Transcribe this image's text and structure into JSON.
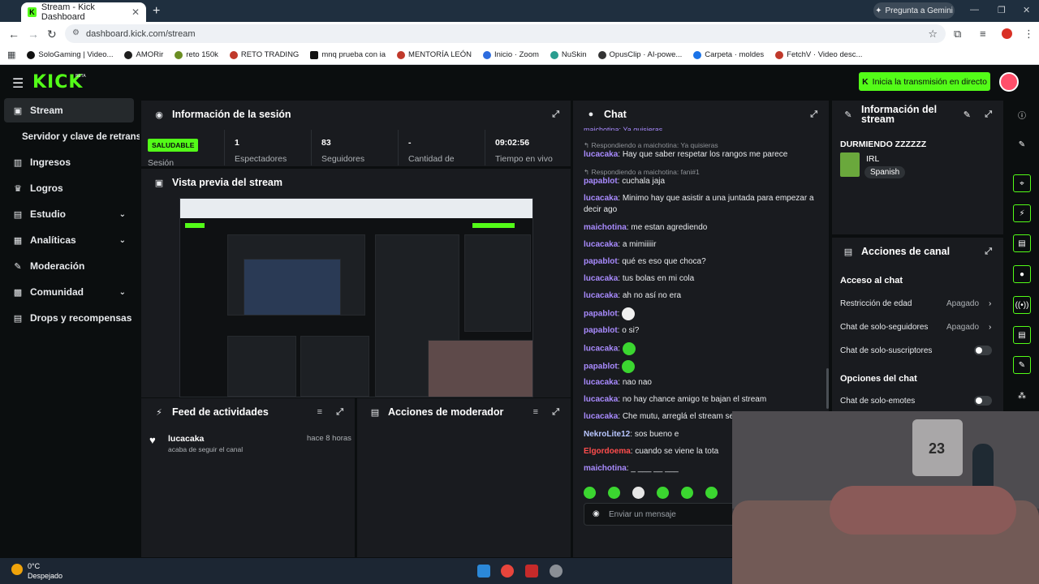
{
  "browser": {
    "tab_title": "Stream - Kick Dashboard",
    "url": "dashboard.kick.com/stream",
    "gemini_label": "Pregunta a Gemini",
    "bookmarks": [
      "SoloGaming | Video...",
      "AMORir",
      "reto 150k",
      "RETO TRADING",
      "mnq prueba con ia",
      "MENTORÍA LEÓN",
      "Inicio · Zoom",
      "NuSkin",
      "OpusClip · AI-powe...",
      "Carpeta · moldes",
      "FetchV · Video desc..."
    ]
  },
  "app": {
    "logo": "KICK",
    "beta": "BETA",
    "go_live_label": "Inicia la transmisión en directo"
  },
  "sidebar": {
    "items": [
      {
        "label": "Stream",
        "icon": "stream-icon"
      },
      {
        "label": "Servidor y clave de retransmisión"
      },
      {
        "label": "Ingresos",
        "icon": "chart-icon"
      },
      {
        "label": "Logros",
        "icon": "trophy-icon"
      },
      {
        "label": "Estudio",
        "icon": "studio-icon"
      },
      {
        "label": "Analíticas",
        "icon": "analytics-icon"
      },
      {
        "label": "Moderación",
        "icon": "wrench-icon"
      },
      {
        "label": "Comunidad",
        "icon": "community-icon"
      },
      {
        "label": "Drops y recompensas",
        "icon": "drops-icon"
      }
    ]
  },
  "session": {
    "title": "Información de la sesión",
    "health_badge": "SALUDABLE",
    "session_label": "Sesión",
    "stats": [
      {
        "value": "1",
        "label": "Espectadores"
      },
      {
        "value": "83",
        "label": "Seguidores"
      },
      {
        "value": "-",
        "label": "Cantidad de"
      },
      {
        "value": "09:02:56",
        "label": "Tiempo en vivo"
      }
    ]
  },
  "preview": {
    "title": "Vista previa del stream"
  },
  "activity": {
    "title": "Feed de actividades",
    "items": [
      {
        "user": "lucacaka",
        "time": "hace 8 horas",
        "desc": "acaba de seguir el canal"
      }
    ]
  },
  "moderator": {
    "title": "Acciones de moderador"
  },
  "chat": {
    "title": "Chat",
    "top_cut": "maichotina: Ya quisieras",
    "messages": [
      {
        "reply": "Respondiendo a maichotina: Ya quisieras",
        "user": "lucacaka",
        "color": "#a98bff",
        "text": "Hay que saber respetar los rangos me parece"
      },
      {
        "reply": "Respondiendo a maichotina: fani#1",
        "user": "papablot",
        "color": "#a98bff",
        "text": "cuchala jaja"
      },
      {
        "user": "lucacaka",
        "color": "#a98bff",
        "text": "Minimo hay que asistir a una juntada para empezar a decir ago"
      },
      {
        "user": "maichotina",
        "color": "#a98bff",
        "text": "me estan agrediendo"
      },
      {
        "user": "lucacaka",
        "color": "#a98bff",
        "text": "a mimiiiiir"
      },
      {
        "user": "papablot",
        "color": "#a98bff",
        "text": "qué es eso que choca?"
      },
      {
        "user": "lucacaka",
        "color": "#a98bff",
        "text": "tus bolas en mi cola"
      },
      {
        "user": "lucacaka",
        "color": "#a98bff",
        "text": "ah no así no era"
      },
      {
        "user": "papablot",
        "color": "#a98bff",
        "text": ""
      },
      {
        "user": "papablot",
        "color": "#a98bff",
        "text": "o si?"
      },
      {
        "user": "lucacaka",
        "color": "#a98bff",
        "text": ""
      },
      {
        "user": "papablot",
        "color": "#a98bff",
        "text": ""
      },
      {
        "user": "lucacaka",
        "color": "#a98bff",
        "text": "nao nao"
      },
      {
        "user": "lucacaka",
        "color": "#a98bff",
        "text": "no hay chance amigo te bajan el stream"
      },
      {
        "user": "lucacaka",
        "color": "#a98bff",
        "text": "Che mutu, arreglá el stream se"
      },
      {
        "user": "NekroLite12",
        "color": "#b9c6ff",
        "text": "sos bueno e"
      },
      {
        "user": "Elgordoema",
        "color": "#ff4d4d",
        "text": "cuando se viene la tota"
      },
      {
        "user": "maichotina",
        "color": "#a98bff",
        "text": "_ ___ __ ___"
      }
    ],
    "input_placeholder": "Enviar un mensaje"
  },
  "stream_info": {
    "title": "Información del stream",
    "stream_title": "DURMIENDO ZZZZZZ",
    "category": "IRL",
    "language": "Spanish"
  },
  "channel_actions": {
    "title": "Acciones de canal",
    "chat_access_label": "Acceso al chat",
    "rows": [
      {
        "label": "Restricción de edad",
        "value": "Apagado"
      },
      {
        "label": "Chat de solo-seguidores",
        "value": "Apagado"
      },
      {
        "label": "Chat de solo-suscriptores",
        "value": ""
      }
    ],
    "chat_options_label": "Opciones del chat",
    "emotes_only_label": "Chat de solo-emotes"
  },
  "taskbar": {
    "temp": "0°C",
    "weather": "Despejado"
  },
  "webcam": {
    "shirt_number": "23"
  },
  "colors": {
    "kick_green": "#53fc18",
    "panel_bg": "#191b1f",
    "page_bg": "#0b0e0f"
  }
}
